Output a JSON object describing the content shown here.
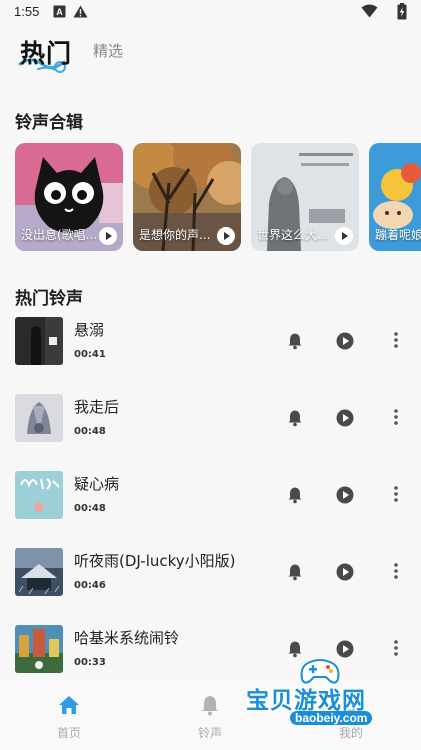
{
  "status_bar": {
    "time": "1:55",
    "icons": [
      "a-icon",
      "warning-icon",
      "wifi-icon",
      "battery-charging-icon"
    ]
  },
  "top_tabs": {
    "hot": "热门",
    "featured": "精选"
  },
  "collections": {
    "title": "铃声合辑",
    "cards": [
      {
        "label": "没出息(歌唱..."
      },
      {
        "label": "是想你的声..."
      },
      {
        "label": "世界这么大..."
      },
      {
        "label": "蹦着呢娘"
      }
    ]
  },
  "hot_ringtones": {
    "title": "热门铃声",
    "items": [
      {
        "title": "悬溺",
        "duration": "00:41"
      },
      {
        "title": "我走后",
        "duration": "00:48"
      },
      {
        "title": "疑心病",
        "duration": "00:48"
      },
      {
        "title": "听夜雨(DJ-lucky小阳版)",
        "duration": "00:46"
      },
      {
        "title": "哈基米系统闹铃",
        "duration": "00:33"
      }
    ]
  },
  "bottom_nav": {
    "home": "首页",
    "ringtone": "铃声",
    "mine": "我的"
  },
  "watermark": {
    "text": "宝贝游戏网",
    "url": "baobeiy.com"
  },
  "colors": {
    "accent": "#1a8fd8",
    "icon_gray": "#4a4a4a",
    "nav_inactive": "#b3b3b3",
    "nav_home": "#2d9be6"
  }
}
